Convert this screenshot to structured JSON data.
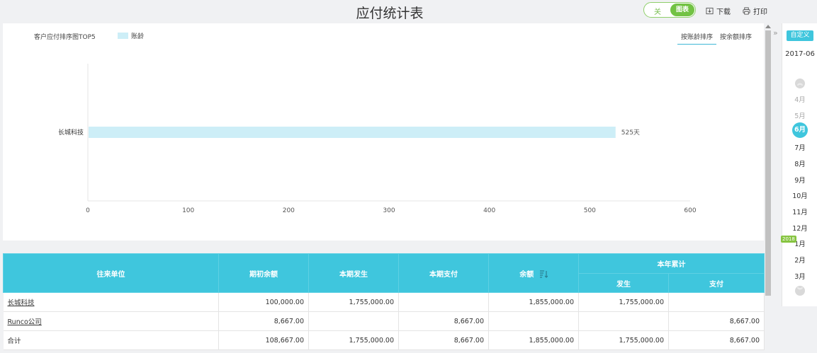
{
  "header": {
    "title": "应付统计表",
    "toggle_off": "关",
    "toggle_on": "图表",
    "download": "下载",
    "print": "打印"
  },
  "chart": {
    "title": "客户应付排序图TOP5",
    "legend": "账龄",
    "sort_by_age": "按账龄排序",
    "sort_by_amount": "按余额排序",
    "colors": {
      "bar": "#cdeef7",
      "axis": "#dddddd"
    }
  },
  "chart_data": {
    "type": "bar",
    "orientation": "horizontal",
    "title": "客户应付排序图TOP5",
    "categories": [
      "长城科技"
    ],
    "series": [
      {
        "name": "账龄",
        "values": [
          525
        ]
      }
    ],
    "value_suffix": "天",
    "xlim": [
      0,
      600
    ],
    "xticks": [
      0,
      100,
      200,
      300,
      400,
      500,
      600
    ],
    "legend": "top-left"
  },
  "table": {
    "headers": {
      "partner": "往来单位",
      "opening": "期初余额",
      "period_incurred": "本期发生",
      "period_paid": "本期支付",
      "balance": "余额",
      "ytd": "本年累计",
      "ytd_incurred": "发生",
      "ytd_paid": "支付"
    },
    "rows": [
      {
        "partner": "长城科技",
        "opening": "100,000.00",
        "period_incurred": "1,755,000.00",
        "period_paid": "",
        "balance": "1,855,000.00",
        "ytd_incurred": "1,755,000.00",
        "ytd_paid": ""
      },
      {
        "partner": "Runco公司",
        "opening": "8,667.00",
        "period_incurred": "",
        "period_paid": "8,667.00",
        "balance": "",
        "ytd_incurred": "",
        "ytd_paid": "8,667.00"
      },
      {
        "partner": "合计",
        "opening": "108,667.00",
        "period_incurred": "1,755,000.00",
        "period_paid": "8,667.00",
        "balance": "1,855,000.00",
        "ytd_incurred": "1,755,000.00",
        "ytd_paid": "8,667.00"
      }
    ]
  },
  "sidebar": {
    "custom": "自定义",
    "current_period": "2017-06",
    "year_badge": "2018",
    "months": [
      "4月",
      "5月",
      "6月",
      "7月",
      "8月",
      "9月",
      "10月",
      "11月",
      "12月",
      "1月",
      "2月",
      "3月"
    ],
    "active_month": "6月",
    "expand_icon": "double-chevron-right-icon",
    "up_icon": "double-chevron-up-icon",
    "down_icon": "double-chevron-down-icon"
  }
}
